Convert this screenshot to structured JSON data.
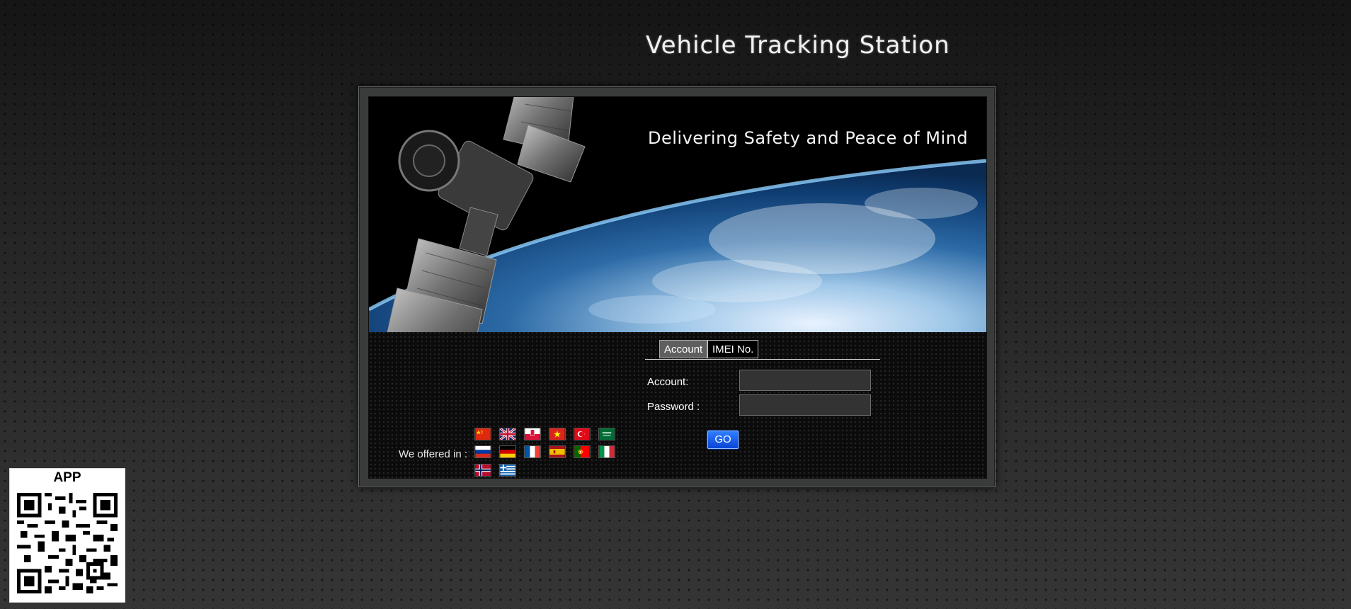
{
  "header": {
    "title": "Vehicle Tracking Station"
  },
  "banner": {
    "slogan": "Delivering Safety and Peace of Mind"
  },
  "login": {
    "tabs": [
      {
        "label": "Account",
        "active": true
      },
      {
        "label": "IMEI No.",
        "active": false
      }
    ],
    "account_label": "Account:",
    "password_label": "Password :",
    "account_value": "",
    "password_value": "",
    "go_label": "GO"
  },
  "languages": {
    "label": "We offered in :",
    "flags": [
      "china",
      "united-kingdom",
      "poland",
      "vietnam",
      "turkey",
      "saudi-arabia",
      "russia",
      "germany",
      "france",
      "spain",
      "portugal",
      "italy",
      "norway",
      "greece"
    ]
  },
  "app": {
    "label": "APP",
    "qr_icon": "qr-code-icon"
  },
  "colors": {
    "go_button": "#1456e6",
    "background": "#2a2a2a"
  }
}
